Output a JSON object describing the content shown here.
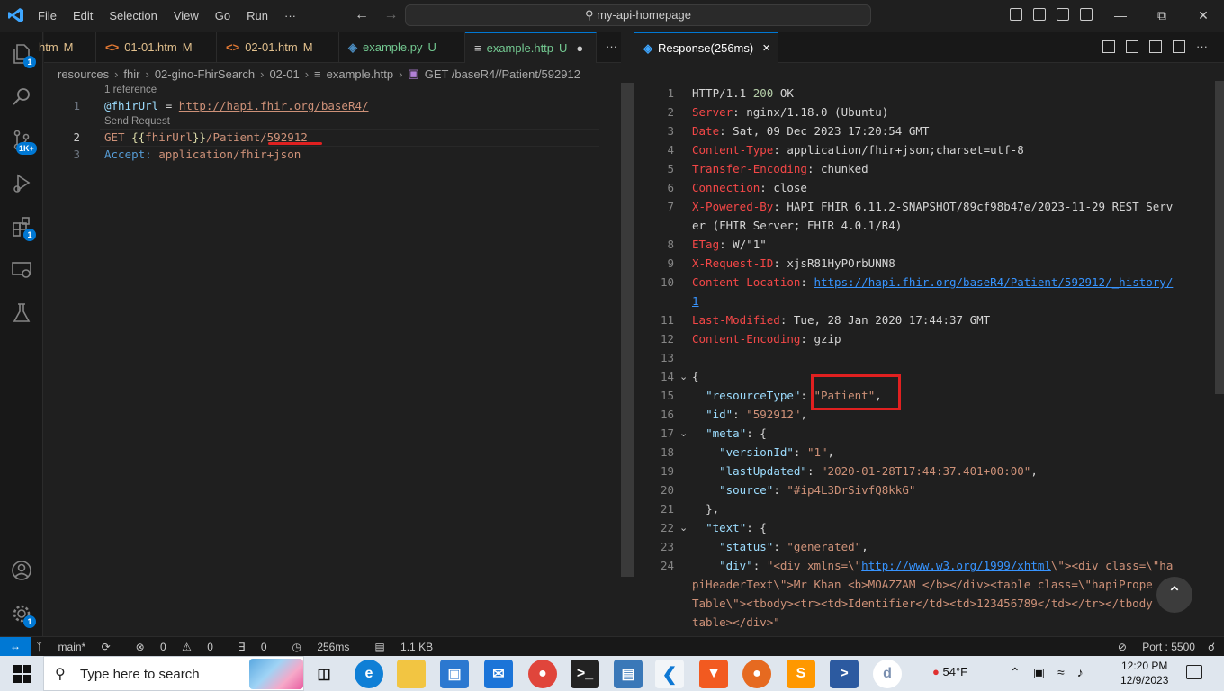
{
  "titlebar": {
    "menu": [
      "File",
      "Edit",
      "Selection",
      "View",
      "Go",
      "Run",
      "···"
    ],
    "back_icon": "arrow-left-icon",
    "forward_icon": "arrow-right-icon",
    "search_text": "my-api-homepage"
  },
  "activity": {
    "explorer_badge": "1",
    "scm_badge": "1K+",
    "extensions_badge": "1",
    "settings_badge": "1"
  },
  "tabs": [
    {
      "label": "htm",
      "status": "M",
      "icon": "",
      "color": "#e2c08d"
    },
    {
      "label": "01-01.htm",
      "status": "M",
      "icon": "<>",
      "color": "#e2c08d"
    },
    {
      "label": "02-01.htm",
      "status": "M",
      "icon": "<>",
      "color": "#e2c08d"
    },
    {
      "label": "example.py",
      "status": "U",
      "icon": "py",
      "color": "#73c991"
    },
    {
      "label": "example.http",
      "status": "U",
      "icon": "≡",
      "color": "#73c991"
    }
  ],
  "response_tab": {
    "label": "Response(256ms)",
    "close": "×"
  },
  "breadcrumb": [
    "resources",
    "fhir",
    "02-gino-FhirSearch",
    "02-01",
    "example.http",
    "GET /baseR4//Patient/592912"
  ],
  "request": {
    "codelens_refs": "1 reference",
    "codelens_send": "Send Request",
    "line1_var": "@fhirUrl",
    "line1_eq": " = ",
    "line1_url": "http://hapi.fhir.org/baseR4/",
    "line2_method": "GET ",
    "line2_open": "{{",
    "line2_var": "fhirUrl",
    "line2_close": "}}",
    "line2_path": "/Patient/",
    "line2_id": "592912",
    "line3_key": "Accept: ",
    "line3_val": "application/fhir+json"
  },
  "response": {
    "status_line": {
      "proto": "HTTP/1.1 ",
      "code": "200",
      "text": " OK"
    },
    "headers": [
      {
        "k": "Server",
        "v": "nginx/1.18.0 (Ubuntu)"
      },
      {
        "k": "Date",
        "v": "Sat, 09 Dec 2023 17:20:54 GMT"
      },
      {
        "k": "Content-Type",
        "v": "application/fhir+json;charset=utf-8"
      },
      {
        "k": "Transfer-Encoding",
        "v": "chunked"
      },
      {
        "k": "Connection",
        "v": "close"
      },
      {
        "k": "X-Powered-By",
        "v": "HAPI FHIR 6.11.2-SNAPSHOT/89cf98b47e/2023-11-29 REST Serv"
      },
      {
        "k": "",
        "v": "er (FHIR Server; FHIR 4.0.1/R4)"
      },
      {
        "k": "ETag",
        "v": "W/\"1\""
      },
      {
        "k": "X-Request-ID",
        "v": "xjsR81HyPOrbUNN8"
      },
      {
        "k": "Content-Location",
        "v": "https://hapi.fhir.org/baseR4/Patient/592912/_history/"
      },
      {
        "k": "",
        "v": "1"
      },
      {
        "k": "Last-Modified",
        "v": "Tue, 28 Jan 2020 17:44:37 GMT"
      },
      {
        "k": "Content-Encoding",
        "v": "gzip"
      }
    ],
    "body": {
      "open": "{",
      "resourceType_k": "\"resourceType\"",
      "resourceType_v": "\"Patient\"",
      "id_k": "\"id\"",
      "id_v": "\"592912\"",
      "meta_k": "\"meta\"",
      "versionId_k": "\"versionId\"",
      "versionId_v": "\"1\"",
      "lastUpdated_k": "\"lastUpdated\"",
      "lastUpdated_v": "\"2020-01-28T17:44:37.401+00:00\"",
      "source_k": "\"source\"",
      "source_v": "\"#ip4L3DrSivfQ8kkG\"",
      "meta_close": "},",
      "text_k": "\"text\"",
      "status_k": "\"status\"",
      "status_v": "\"generated\"",
      "div_k": "\"div\"",
      "div_v1a": "\"<div xmlns=\\\"",
      "div_v1b": "http://www.w3.org/1999/xhtml",
      "div_v1c": "\\\"><div class=\\\"ha",
      "div_v2": "piHeaderText\\\">Mr Khan <b>MOAZZAM </b></div><table class=\\\"hapiPrope",
      "div_v3": "Table\\\"><tbody><tr><td>Identifier</td><td>123456789</td></tr></tbody",
      "div_v4": "table></div>\""
    }
  },
  "statusbar": {
    "branch": "main*",
    "errors": "0",
    "warnings": "0",
    "ports": "0",
    "time": "256ms",
    "size": "1.1 KB",
    "port": "Port : 5500"
  },
  "taskbar": {
    "search_placeholder": "Type here to search",
    "weather": "54°F",
    "time": "12:20 PM",
    "date": "12/9/2023",
    "apps": [
      "task-view",
      "edge",
      "file-explorer",
      "store",
      "mail",
      "chrome",
      "terminal",
      "remote",
      "vscode",
      "brave",
      "firefox",
      "sublime",
      "powershell",
      "dbeaver"
    ]
  }
}
